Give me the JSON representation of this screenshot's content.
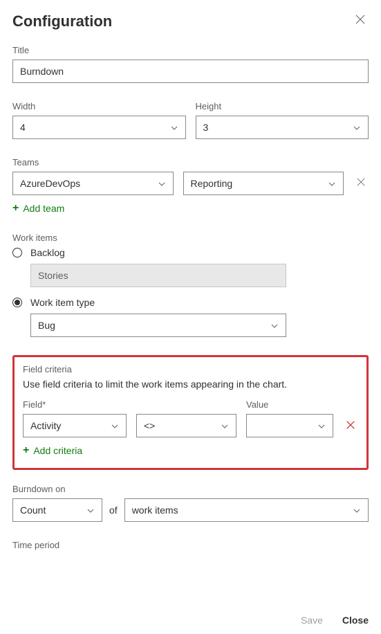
{
  "header": {
    "title": "Configuration"
  },
  "title": {
    "label": "Title",
    "value": "Burndown"
  },
  "width": {
    "label": "Width",
    "value": "4"
  },
  "height": {
    "label": "Height",
    "value": "3"
  },
  "teams": {
    "label": "Teams",
    "team1": "AzureDevOps",
    "team2": "Reporting",
    "add": "Add team"
  },
  "workitems": {
    "label": "Work items",
    "backlog_label": "Backlog",
    "backlog_value": "Stories",
    "type_label": "Work item type",
    "type_value": "Bug"
  },
  "criteria": {
    "section_label": "Field criteria",
    "help": "Use field criteria to limit the work items appearing in the chart.",
    "field_label": "Field",
    "field_value": "Activity",
    "op_value": "<>",
    "value_label": "Value",
    "value_value": "",
    "add": "Add criteria"
  },
  "burndown": {
    "label": "Burndown on",
    "count": "Count",
    "of": "of",
    "unit": "work items"
  },
  "timeperiod": {
    "label": "Time period"
  },
  "footer": {
    "save": "Save",
    "close": "Close"
  }
}
